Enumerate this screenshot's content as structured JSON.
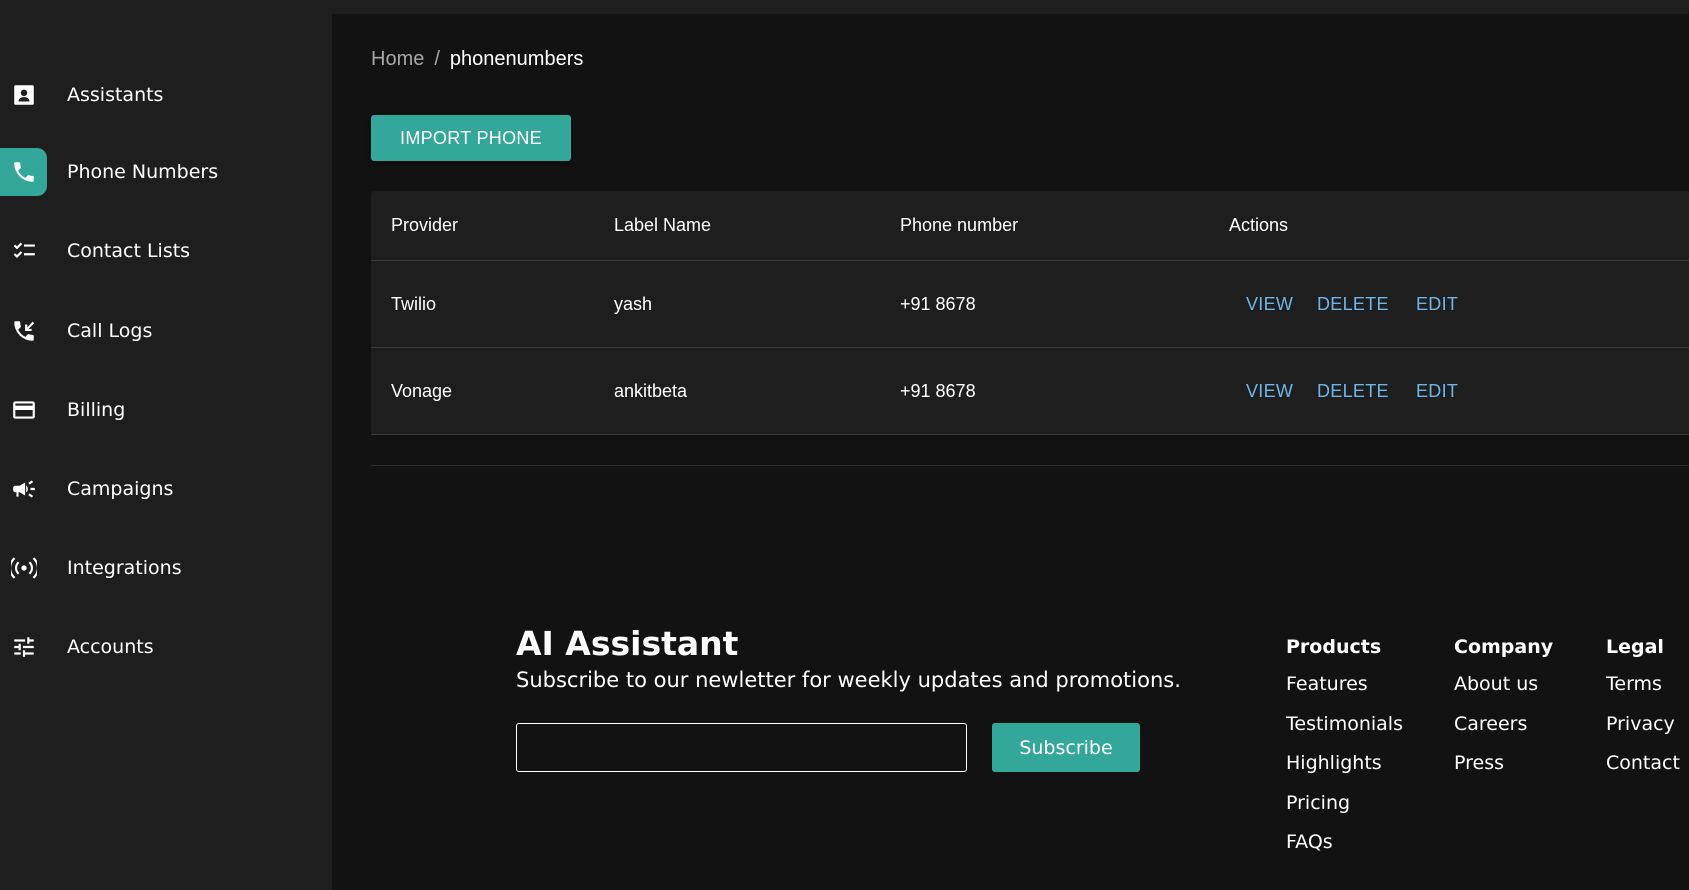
{
  "sidebar": {
    "items": [
      {
        "label": "Assistants",
        "icon": "contact-card-icon"
      },
      {
        "label": "Phone Numbers",
        "icon": "phone-icon",
        "active": true
      },
      {
        "label": "Contact Lists",
        "icon": "checklist-icon"
      },
      {
        "label": "Call Logs",
        "icon": "incoming-call-icon"
      },
      {
        "label": "Billing",
        "icon": "credit-card-icon"
      },
      {
        "label": "Campaigns",
        "icon": "megaphone-icon"
      },
      {
        "label": "Integrations",
        "icon": "broadcast-icon"
      },
      {
        "label": "Accounts",
        "icon": "sliders-icon"
      }
    ]
  },
  "breadcrumb": {
    "home": "Home",
    "separator": "/",
    "current": "phonenumbers"
  },
  "import_button": "IMPORT PHONE",
  "table": {
    "headers": {
      "provider": "Provider",
      "label": "Label Name",
      "phone": "Phone number",
      "actions": "Actions"
    },
    "rows": [
      {
        "provider": "Twilio",
        "label": "yash",
        "phone": "+91 8678",
        "view": "VIEW",
        "delete": "DELETE",
        "edit": "EDIT"
      },
      {
        "provider": "Vonage",
        "label": "ankitbeta",
        "phone": "+91 8678",
        "view": "VIEW",
        "delete": "DELETE",
        "edit": "EDIT"
      }
    ]
  },
  "footer": {
    "brand": "AI Assistant",
    "tagline": "Subscribe to our newletter for weekly updates and promotions.",
    "email_value": "",
    "subscribe_label": "Subscribe",
    "columns": [
      {
        "title": "Products",
        "links": [
          "Features",
          "Testimonials",
          "Highlights",
          "Pricing",
          "FAQs"
        ]
      },
      {
        "title": "Company",
        "links": [
          "About us",
          "Careers",
          "Press"
        ]
      },
      {
        "title": "Legal",
        "links": [
          "Terms",
          "Privacy",
          "Contact"
        ]
      }
    ]
  },
  "colors": {
    "accent": "#33a79a",
    "link": "#6fb6e8",
    "background": "#121212",
    "panel": "#1e1e1e"
  }
}
